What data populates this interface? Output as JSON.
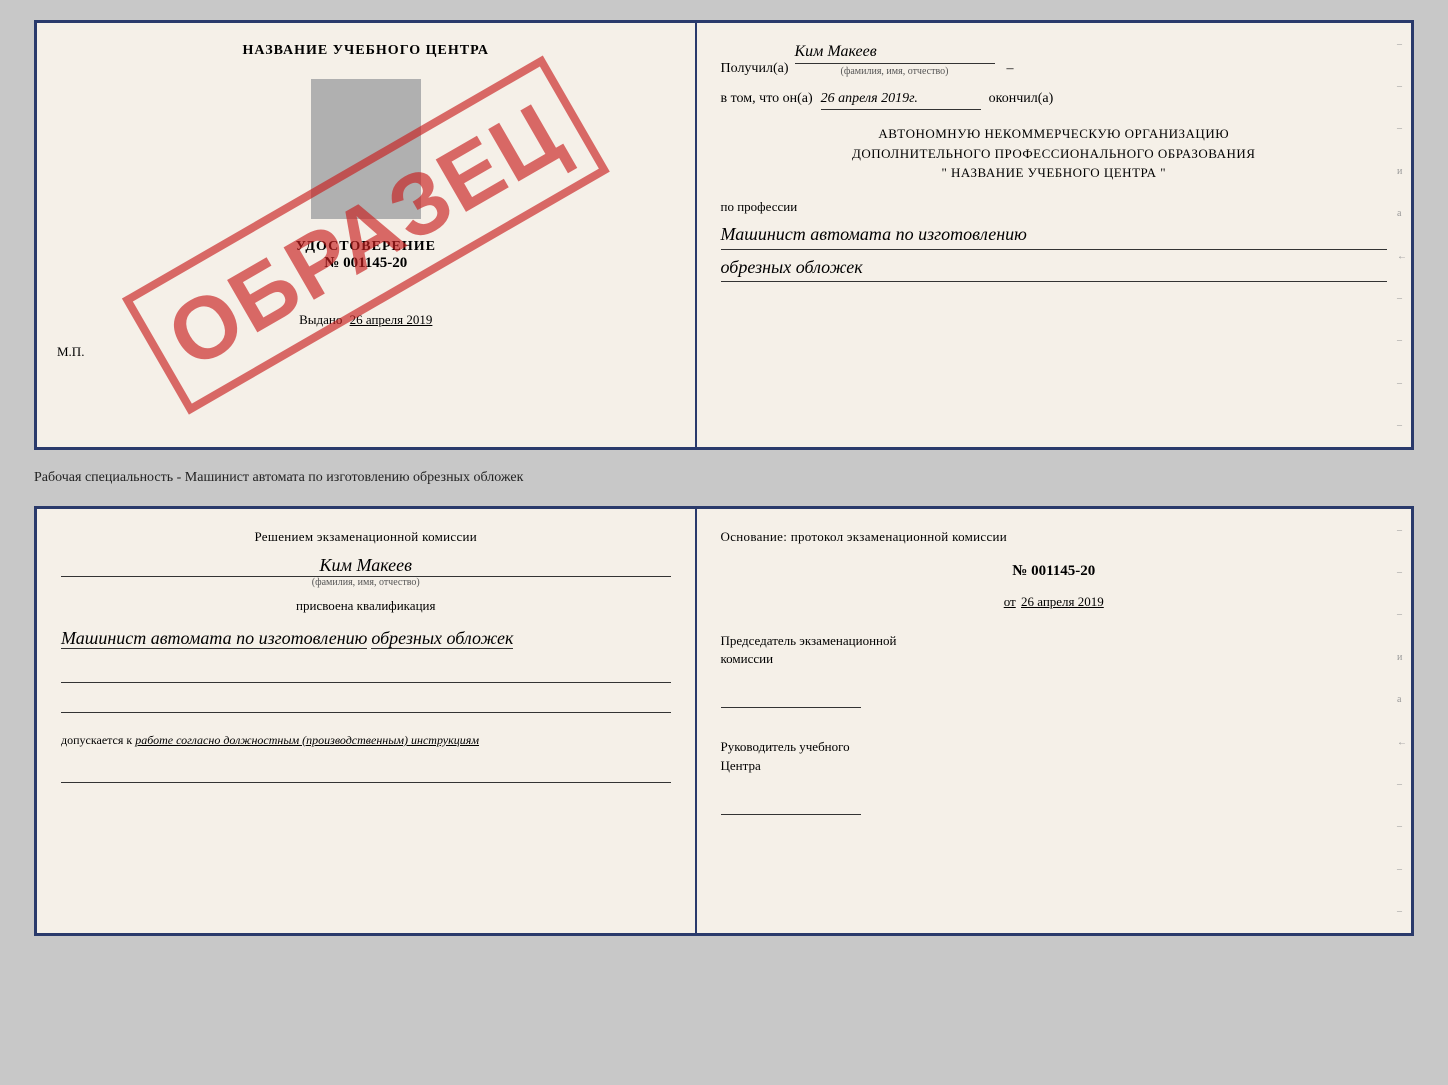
{
  "top_cert": {
    "left": {
      "school_label": "НАЗВАНИЕ УЧЕБНОГО ЦЕНТРА",
      "cert_title": "УДОСТОВЕРЕНИЕ",
      "cert_num": "№ 001145-20",
      "vydano_label": "Выдано",
      "vydano_date": "26 апреля 2019",
      "mp_label": "М.П.",
      "stamp_text": "ОБРАЗЕЦ"
    },
    "right": {
      "poluchil_label": "Получил(а)",
      "poluchil_name": "Ким Макеев",
      "fio_hint": "(фамилия, имя, отчество)",
      "vtom_label": "в том, что он(а)",
      "vtom_date": "26 апреля 2019г.",
      "okonchil_label": "окончил(а)",
      "org_line1": "АВТОНОМНУЮ НЕКОММЕРЧЕСКУЮ ОРГАНИЗАЦИЮ",
      "org_line2": "ДОПОЛНИТЕЛЬНОГО ПРОФЕССИОНАЛЬНОГО ОБРАЗОВАНИЯ",
      "org_line3": "\"   НАЗВАНИЕ УЧЕБНОГО ЦЕНТРА   \"",
      "po_professii_label": "по профессии",
      "profession_line1": "Машинист автомата по изготовлению",
      "profession_line2": "обрезных обложек"
    }
  },
  "between_label": "Рабочая специальность - Машинист автомата по изготовлению обрезных обложек",
  "bottom_cert": {
    "left": {
      "reshenie_label": "Решением экзаменационной комиссии",
      "komissia_name": "Ким Макеев",
      "fio_hint": "(фамилия, имя, отчество)",
      "prisvoena_label": "присвоена квалификация",
      "kval_line1": "Машинист автомата по изготовлению",
      "kval_line2": "обрезных обложек",
      "dopuskaetsya_prefix": "допускается к",
      "dopuskaetsya_text": "работе согласно должностным (производственным) инструкциям"
    },
    "right": {
      "osnovanie_label": "Основание: протокол экзаменационной комиссии",
      "protocol_num": "№ 001145-20",
      "ot_label": "от",
      "ot_date": "26 апреля 2019",
      "predsedatel_line1": "Председатель экзаменационной",
      "predsedatel_line2": "комиссии",
      "rukovoditel_line1": "Руководитель учебного",
      "rukovoditel_line2": "Центра"
    }
  },
  "dashes": [
    "-",
    "-",
    "-",
    "и",
    "а",
    "←",
    "-",
    "-",
    "-",
    "-"
  ],
  "dashes_bottom": [
    "-",
    "-",
    "-",
    "и",
    "а",
    "←",
    "-",
    "-",
    "-",
    "-"
  ]
}
